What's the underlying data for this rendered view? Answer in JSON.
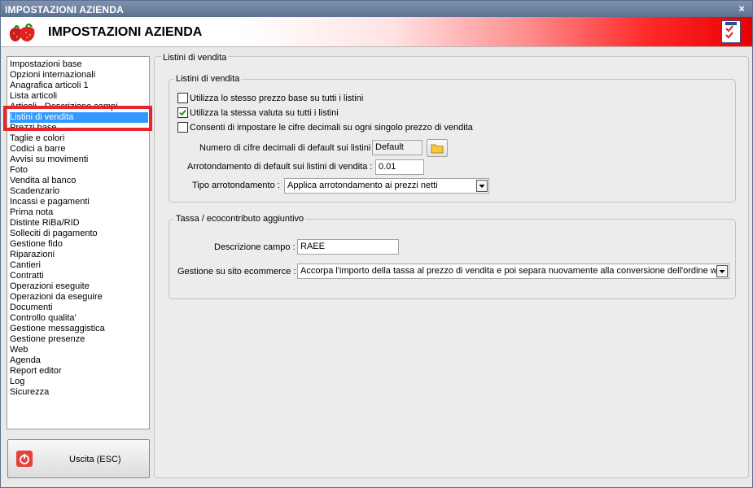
{
  "window": {
    "title": "IMPOSTAZIONI AZIENDA",
    "close_glyph": "×"
  },
  "banner": {
    "title": "IMPOSTAZIONI AZIENDA",
    "logo_icon": "strawberry-icon",
    "right_icon": "checklist-icon"
  },
  "sidebar": {
    "items": [
      "Impostazioni base",
      "Opzioni internazionali",
      "Anagrafica articoli 1",
      "Lista articoli",
      "Articoli - Descrizione campi",
      "Listini di vendita",
      "Prezzi base",
      "Taglie e colori",
      "Codici a barre",
      "Avvisi su movimenti",
      "Foto",
      "Vendita al banco",
      "Scadenzario",
      "Incassi e pagamenti",
      "Prima nota",
      "Distinte RiBa/RID",
      "Solleciti di pagamento",
      "Gestione fido",
      "Riparazioni",
      "Cantieri",
      "Contratti",
      "Operazioni eseguite",
      "Operazioni da eseguire",
      "Documenti",
      "Controllo qualita'",
      "Gestione messaggistica",
      "Gestione presenze",
      "Web",
      "Agenda",
      "Report editor",
      "Log",
      "Sicurezza"
    ],
    "selected": "Listini di vendita"
  },
  "exit_button": {
    "label": "Uscita (ESC)",
    "icon": "power-icon"
  },
  "panel": {
    "title": "Listini di vendita",
    "group1": {
      "title": "Listini di vendita",
      "checkboxes": [
        {
          "label": "Utilizza lo stesso prezzo base su tutti i listini",
          "checked": false
        },
        {
          "label": "Utilizza la stessa valuta su tutti i listini",
          "checked": true
        },
        {
          "label": "Consenti di impostare le cifre decimali su ogni singolo prezzo di vendita",
          "checked": false
        }
      ],
      "decimals_label": "Numero di cifre decimali di default sui listini :",
      "decimals_value": "Default",
      "rounding_label": "Arrotondamento di default sui listini di vendita :",
      "rounding_value": "0.01",
      "rounding_type_label": "Tipo arrotondamento :",
      "rounding_type_value": "Applica arrotondamento ai prezzi netti"
    },
    "group2": {
      "title": "Tassa / ecocontributo aggiuntivo",
      "field_label": "Descrizione campo :",
      "field_value": "RAEE",
      "ecommerce_label": "Gestione su sito ecommerce :",
      "ecommerce_value": "Accorpa l'importo della tassa al prezzo di vendita e poi separa nuovamente alla conversione dell'ordine web"
    }
  }
}
